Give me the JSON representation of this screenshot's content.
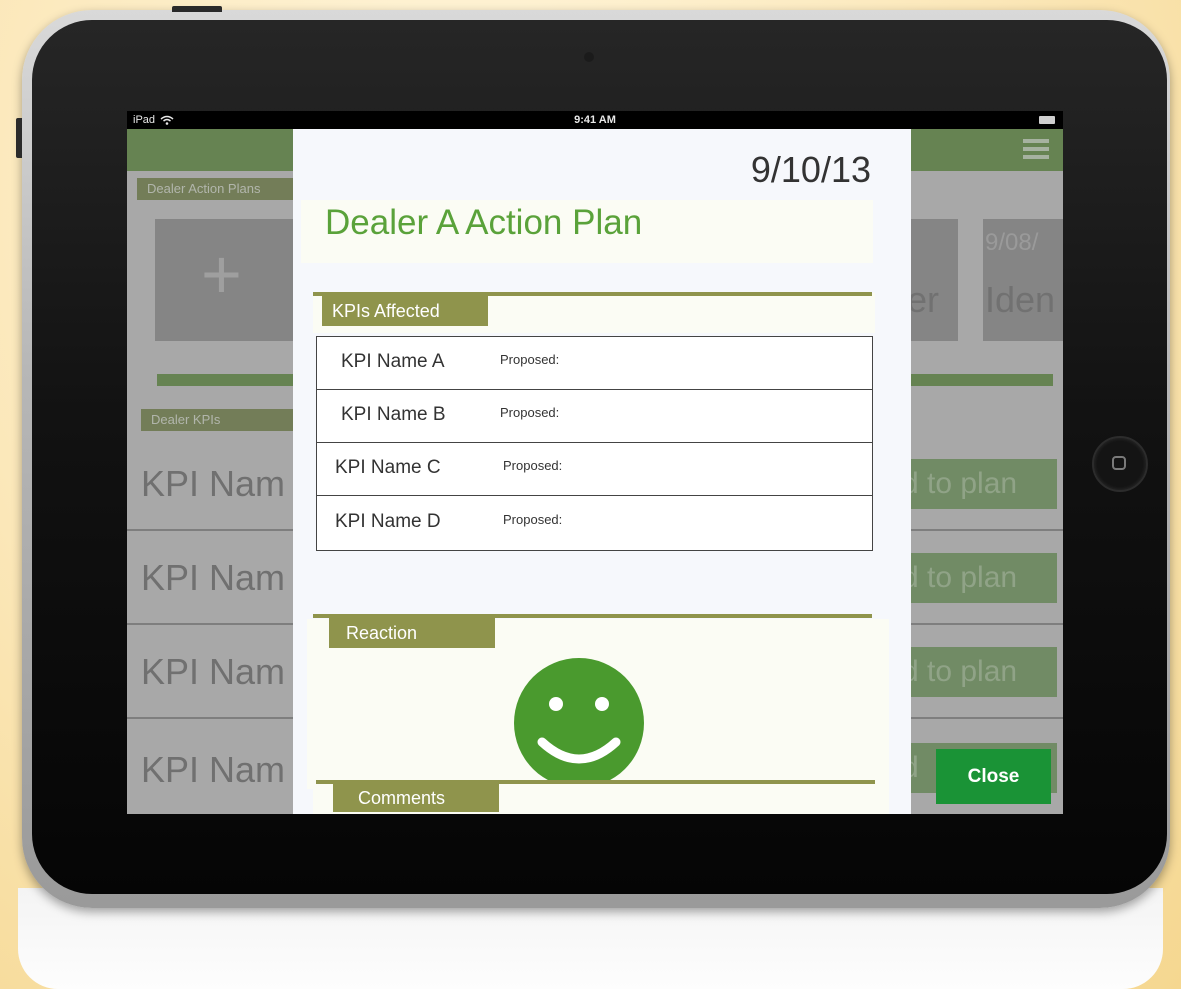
{
  "status_bar": {
    "carrier": "iPad",
    "time": "9:41 AM"
  },
  "app": {
    "action_plans_label": "Dealer Action Plans",
    "new_plan_symbol": "+",
    "tile_date": "9/08/",
    "tile_text_a": "er",
    "tile_text_b": "Iden",
    "kpis_label": "Dealer KPIs",
    "kpi_rows": [
      {
        "label": "KPI Nam",
        "add": "d to plan"
      },
      {
        "label": "KPI Nam",
        "add": "d to plan"
      },
      {
        "label": "KPI Nam",
        "add": "d to plan"
      },
      {
        "label": "KPI Nam",
        "add": "d"
      }
    ]
  },
  "modal": {
    "date": "9/10/13",
    "title": "Dealer A Action Plan",
    "kpis_section": "KPIs Affected",
    "kpis": [
      {
        "name": "KPI Name A",
        "proposed": "Proposed:"
      },
      {
        "name": "KPI Name B",
        "proposed": "Proposed:"
      },
      {
        "name": "KPI Name C",
        "proposed": "Proposed:"
      },
      {
        "name": "KPI Name D",
        "proposed": "Proposed:"
      }
    ],
    "reaction_section": "Reaction",
    "reaction": "happy-face-icon",
    "comments_section": "Comments",
    "close_label": "Close"
  },
  "colors": {
    "accent_green": "#5aa23a",
    "section_olive": "#8f944c",
    "close_button": "#1a9336",
    "smiley": "#4a9a2e"
  }
}
